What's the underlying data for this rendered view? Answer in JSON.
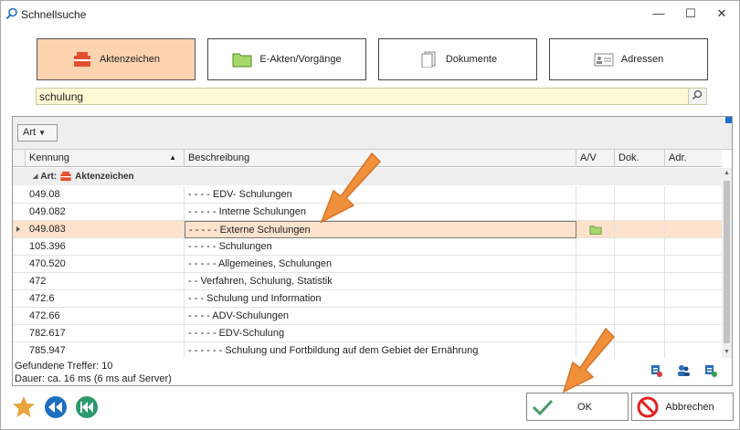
{
  "window": {
    "title": "Schnellsuche",
    "controls": {
      "minimize": "—",
      "maximize": "☐",
      "close": "✕"
    }
  },
  "categories": [
    {
      "label": "Aktenzeichen",
      "active": true,
      "icon": "briefcase-icon"
    },
    {
      "label": "E-Akten/Vorgänge",
      "active": false,
      "icon": "folder-icon"
    },
    {
      "label": "Dokumente",
      "active": false,
      "icon": "document-icon"
    },
    {
      "label": "Adressen",
      "active": false,
      "icon": "address-card-icon"
    }
  ],
  "search": {
    "value": "schulung",
    "icon": "search-icon"
  },
  "grid": {
    "filter_button": "Art",
    "columns": [
      "Kennung",
      "Beschreibung",
      "A/V",
      "Dok.",
      "Adr."
    ],
    "group_label": "Art:",
    "group_value": "Aktenzeichen",
    "rows": [
      {
        "kennung": "049.08",
        "beschreibung": "- - - - EDV- Schulungen"
      },
      {
        "kennung": "049.082",
        "beschreibung": "- - - - - Interne Schulungen"
      },
      {
        "kennung": "049.083",
        "beschreibung": "- - - - - Externe Schulungen",
        "selected": true,
        "av_icon": "folder-icon"
      },
      {
        "kennung": "105.396",
        "beschreibung": "- - - - - Schulungen"
      },
      {
        "kennung": "470.520",
        "beschreibung": "- - - - - Allgemeines, Schulungen"
      },
      {
        "kennung": "472",
        "beschreibung": "- - Verfahren, Schulung, Statistik"
      },
      {
        "kennung": "472.6",
        "beschreibung": "- - - Schulung und Information"
      },
      {
        "kennung": "472.66",
        "beschreibung": "- - - - ADV-Schulungen"
      },
      {
        "kennung": "782.617",
        "beschreibung": "- - - - - EDV-Schulung"
      },
      {
        "kennung": "785.947",
        "beschreibung": "- - - - - - Schulung und Fortbildung auf dem Gebiet der Ernährung"
      }
    ]
  },
  "status": {
    "found": "Gefundene Treffer: 10",
    "duration": "Dauer: ca. 16 ms (6 ms auf Server)"
  },
  "buttons": {
    "ok": "OK",
    "cancel": "Abbrechen"
  },
  "colors": {
    "active_category": "#fdd3b0",
    "selected_row": "#fde2cc",
    "search_bg": "#fff9d6",
    "arrow": "#f0903a"
  }
}
